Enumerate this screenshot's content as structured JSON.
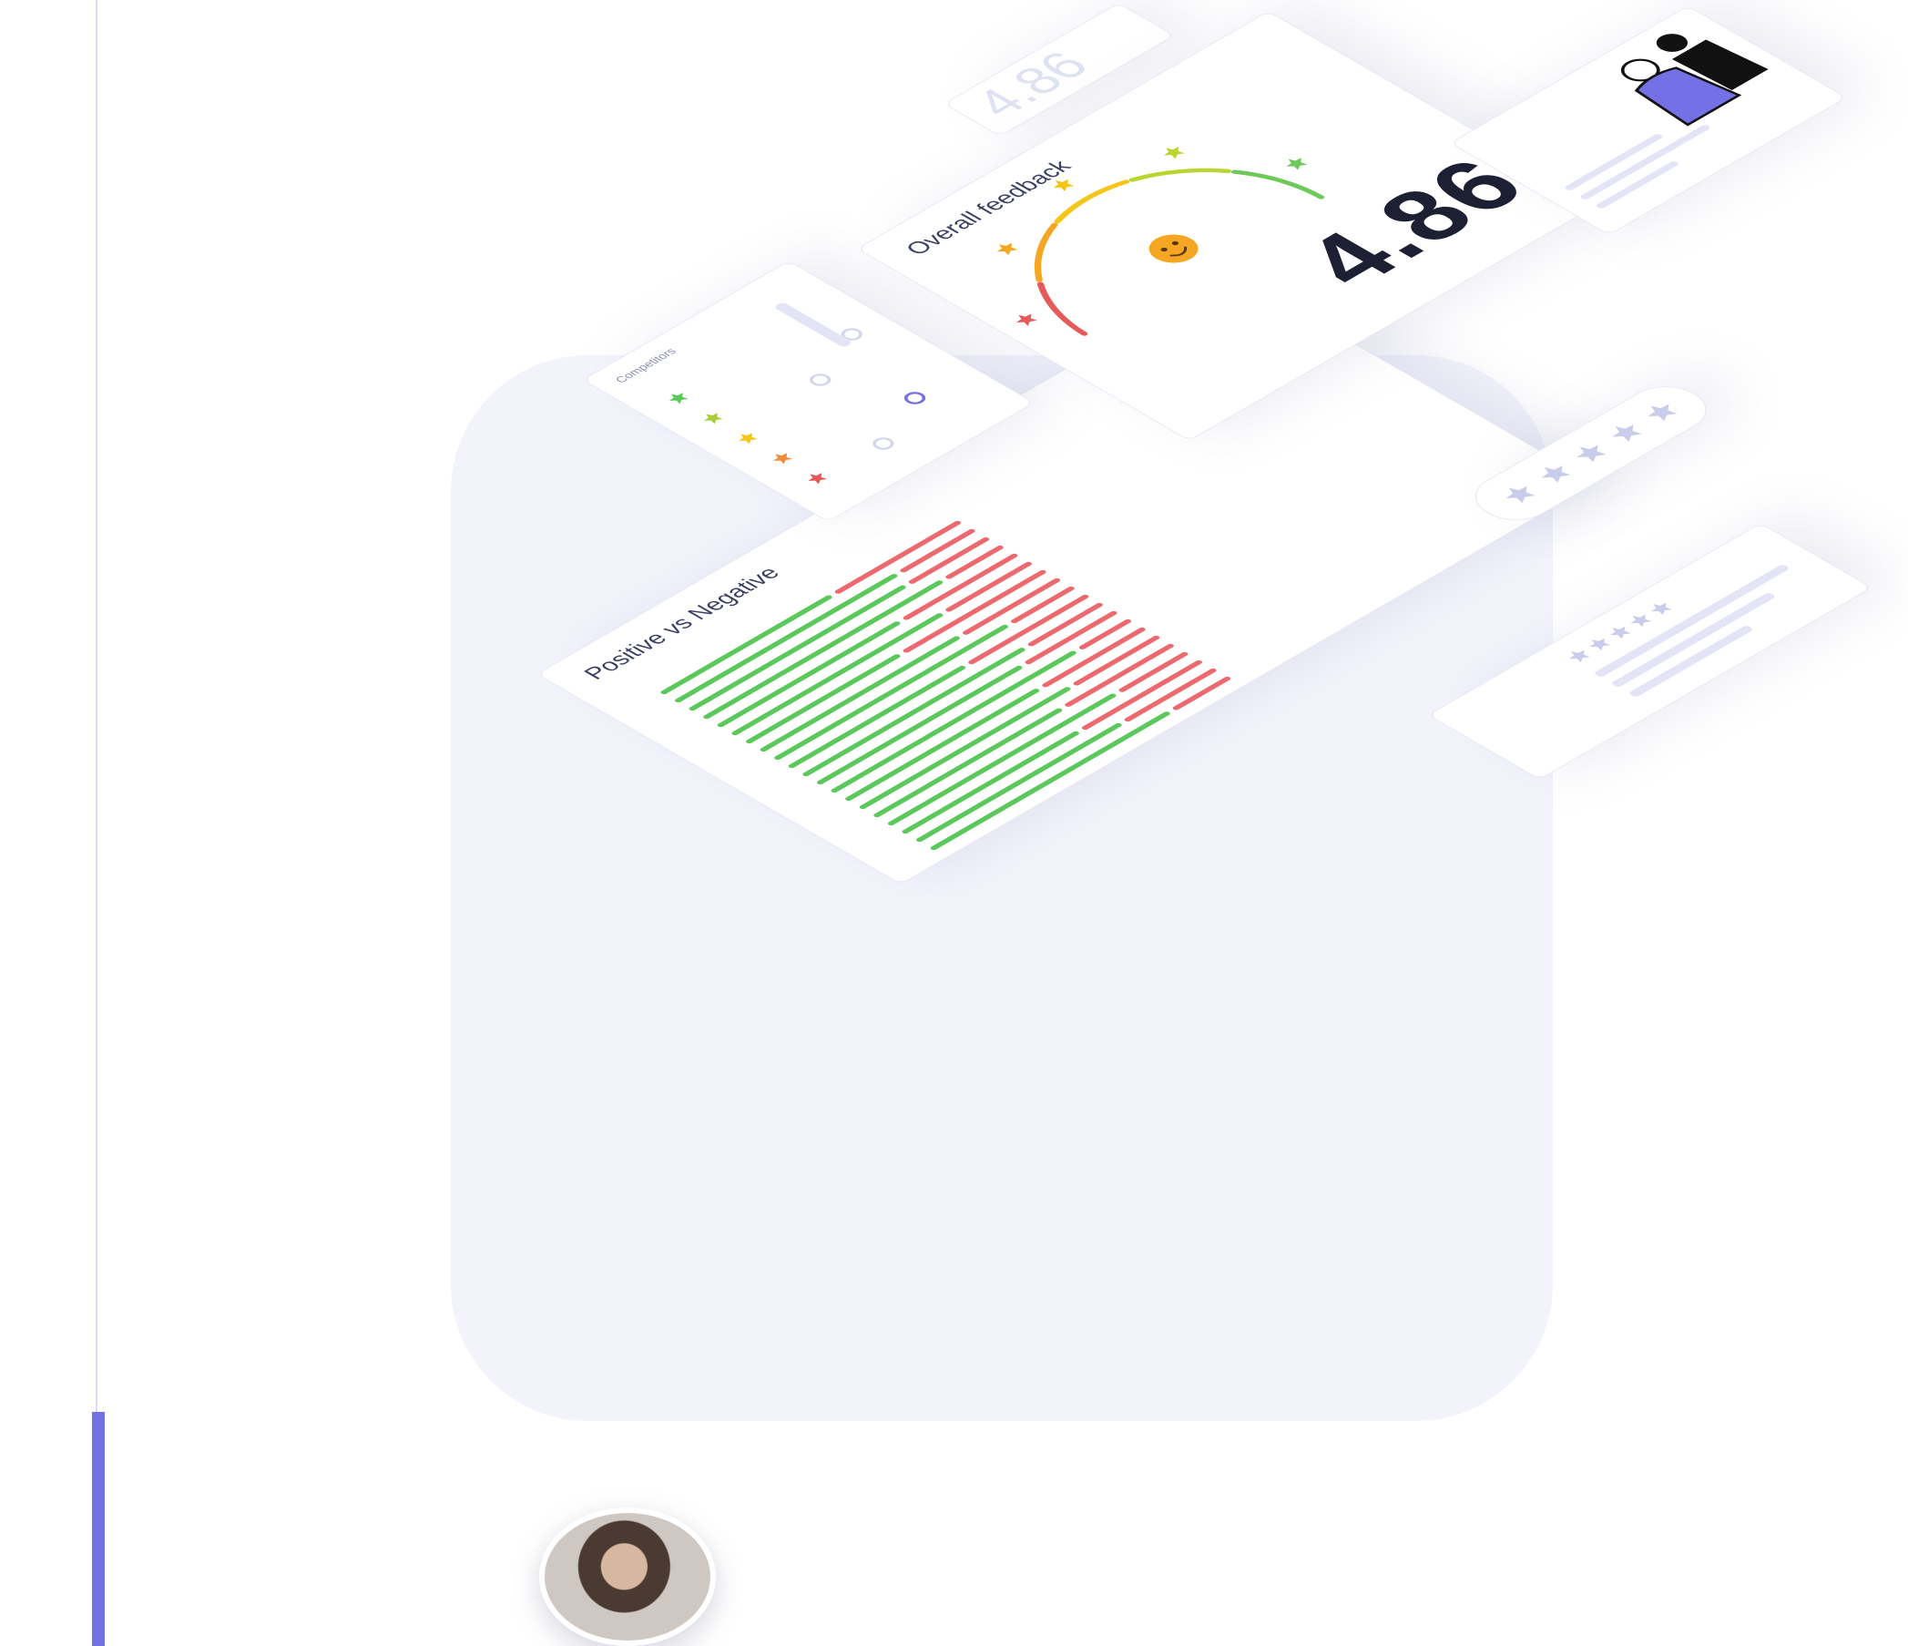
{
  "overall_feedback": {
    "title": "Overall feedback",
    "score": "4.86",
    "gauge_segment_colors": [
      "#e65a5a",
      "#f5a623",
      "#f5c518",
      "#b9d62f",
      "#6cc95a"
    ],
    "face_color": "#f5a623"
  },
  "ghost_score": {
    "value": "4.86"
  },
  "competitors": {
    "title": "Competitors",
    "star_colors": [
      "#5ac85a",
      "#a8cf3a",
      "#f5c518",
      "#f08c3a",
      "#e65a5a"
    ]
  },
  "positive_vs_negative": {
    "title": "Positive vs Negative",
    "positive_color": "#5ac85a",
    "negative_color": "#ec6a6f"
  },
  "review_card": {
    "star_count": 5,
    "star_color": "#c9cceb"
  },
  "rating_pill": {
    "star_count": 5,
    "star_color": "#c9cceb"
  },
  "illustration": {
    "accent_color": "#7471e6"
  },
  "chart_data": {
    "type": "bar",
    "title": "Positive vs Negative",
    "series": [
      {
        "values": [
          0.58,
          0.76,
          0.74,
          0.82,
          0.62,
          0.72,
          0.52,
          0.68,
          0.8,
          0.6,
          0.76,
          0.7,
          0.84,
          0.66,
          0.72,
          0.64,
          0.78,
          0.6,
          0.7,
          0.82
        ]
      },
      {
        "values": [
          0.42,
          0.24,
          0.26,
          0.18,
          0.38,
          0.28,
          0.48,
          0.32,
          0.2,
          0.4,
          0.24,
          0.3,
          0.16,
          0.34,
          0.28,
          0.36,
          0.22,
          0.4,
          0.3,
          0.18
        ]
      }
    ]
  }
}
